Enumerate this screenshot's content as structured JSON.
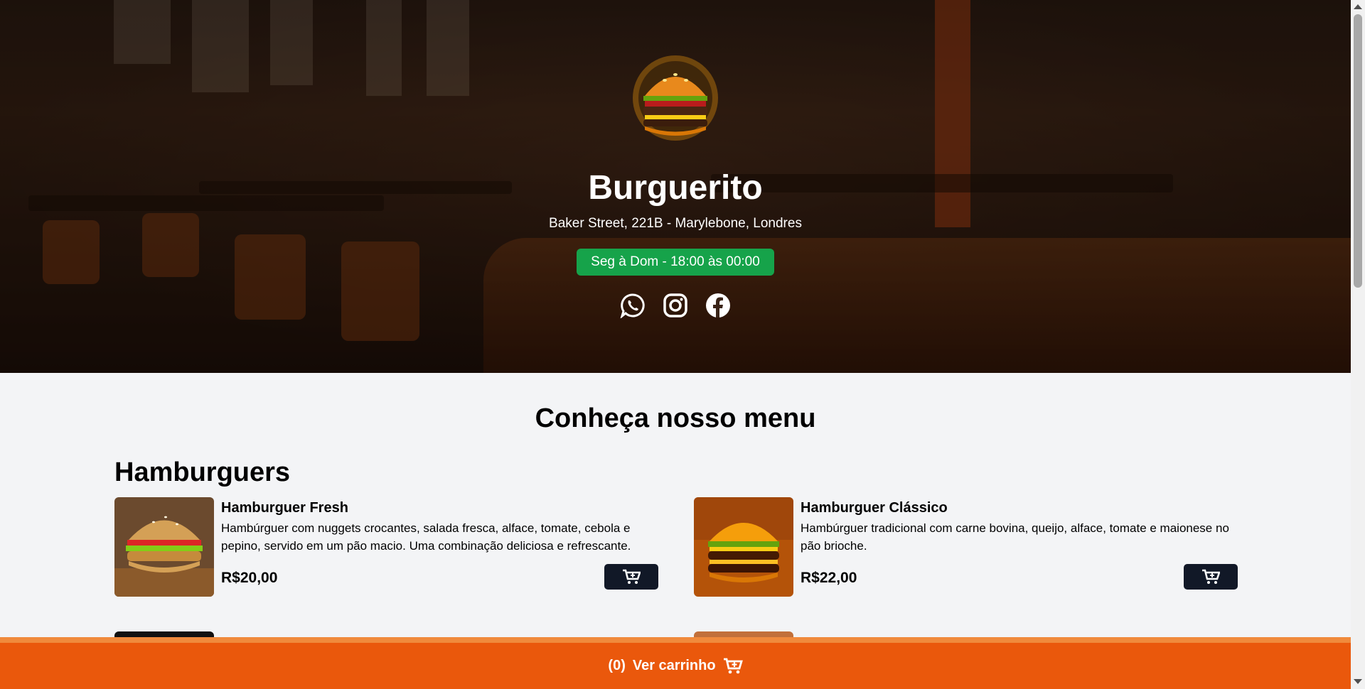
{
  "restaurant": {
    "name": "Burguerito",
    "address": "Baker Street, 221B - Marylebone, Londres",
    "hours": "Seg à Dom - 18:00 às 00:00"
  },
  "socials": [
    {
      "name": "whatsapp-icon"
    },
    {
      "name": "instagram-icon"
    },
    {
      "name": "facebook-icon"
    }
  ],
  "menu": {
    "title": "Conheça nosso menu",
    "section": "Hamburguers",
    "items": [
      {
        "name": "Hamburguer Fresh",
        "description": "Hambúrguer com nuggets crocantes, salada fresca, alface, tomate, cebola e pepino, servido em um pão macio. Uma combinação deliciosa e refrescante.",
        "price": "R$20,00"
      },
      {
        "name": "Hamburguer Clássico",
        "description": "Hambúrguer tradicional com carne bovina, queijo, alface, tomate e maionese no pão brioche.",
        "price": "R$22,00"
      }
    ]
  },
  "cart": {
    "count": "(0)",
    "label": "Ver carrinho"
  },
  "colors": {
    "hours_badge": "#16a34a",
    "cart_bar": "#ea580c",
    "cart_button": "#111827"
  }
}
